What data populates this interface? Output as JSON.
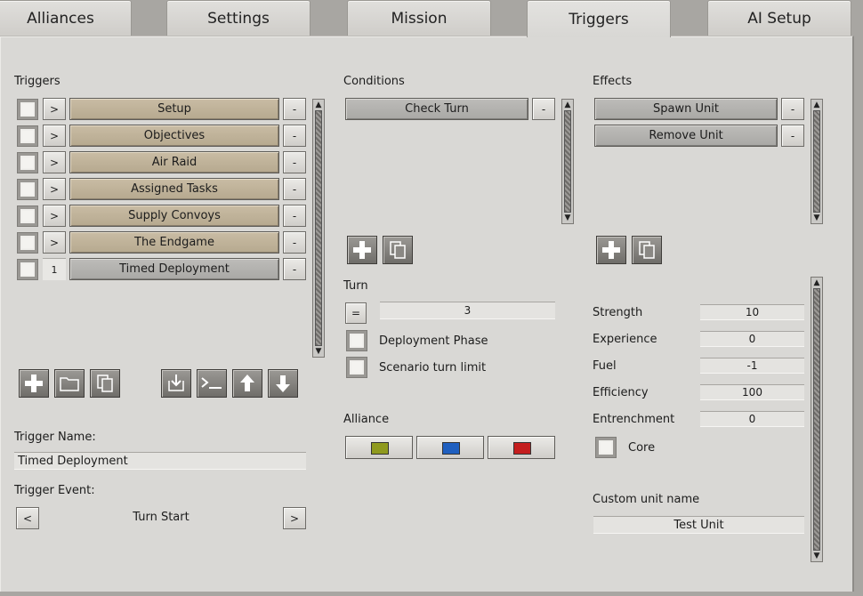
{
  "tabs": [
    "Alliances",
    "Settings",
    "Mission",
    "Triggers",
    "AI Setup"
  ],
  "triggers": {
    "header": "Triggers",
    "items": [
      {
        "expand": ">",
        "name": "Setup"
      },
      {
        "expand": ">",
        "name": "Objectives"
      },
      {
        "expand": ">",
        "name": "Air Raid"
      },
      {
        "expand": ">",
        "name": "Assigned Tasks"
      },
      {
        "expand": ">",
        "name": "Supply Convoys"
      },
      {
        "expand": ">",
        "name": "The Endgame"
      },
      {
        "expand": "1",
        "name": "Timed Deployment"
      }
    ],
    "remove_label": "-",
    "name_label": "Trigger Name:",
    "name_value": "Timed Deployment",
    "event_label": "Trigger Event:",
    "event_prev": "<",
    "event_value": "Turn Start",
    "event_next": ">"
  },
  "conditions": {
    "header": "Conditions",
    "items": [
      "Check Turn"
    ],
    "remove_label": "-",
    "turn_label": "Turn",
    "turn_op": "=",
    "turn_value": "3",
    "deployment_phase": "Deployment Phase",
    "scenario_limit": "Scenario turn limit",
    "alliance_label": "Alliance",
    "alliance_colors": [
      "#8f9a1e",
      "#1f5fbf",
      "#c41e1e"
    ]
  },
  "effects": {
    "header": "Effects",
    "items": [
      "Spawn Unit",
      "Remove Unit"
    ],
    "remove_label": "-",
    "stats": [
      {
        "label": "Strength",
        "value": "10"
      },
      {
        "label": "Experience",
        "value": "0"
      },
      {
        "label": "Fuel",
        "value": "-1"
      },
      {
        "label": "Efficiency",
        "value": "100"
      },
      {
        "label": "Entrenchment",
        "value": "0"
      }
    ],
    "core_label": "Core",
    "custom_name_label": "Custom unit name",
    "custom_name_value": "Test Unit"
  }
}
